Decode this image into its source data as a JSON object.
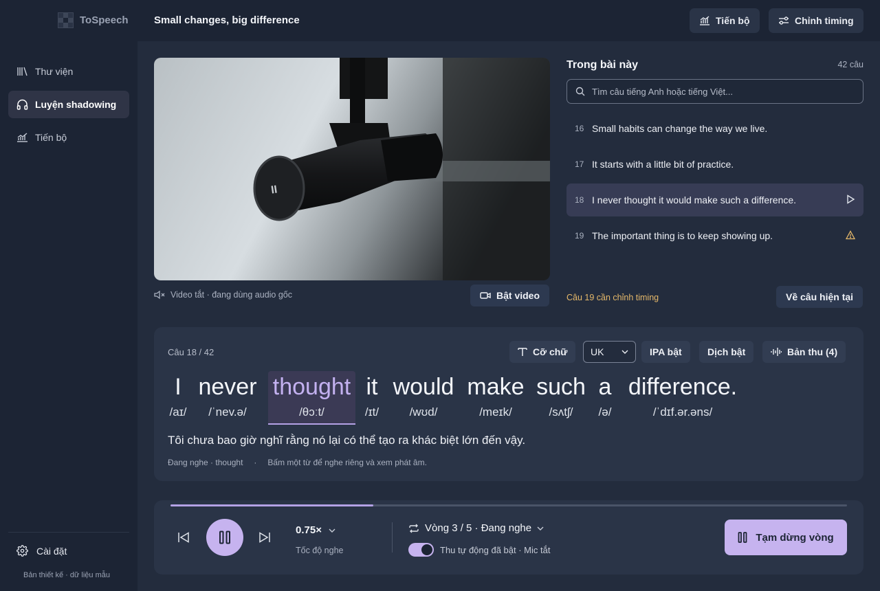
{
  "app": {
    "brand": "ToSpeech",
    "page_title": "Small changes, big difference"
  },
  "header": {
    "progress_label": "Tiến bộ",
    "timing_label": "Chỉnh timing"
  },
  "sidebar": {
    "items": [
      {
        "label": "Thư viện",
        "icon": "library-icon"
      },
      {
        "label": "Luyện shadowing",
        "icon": "headphones-icon",
        "active": true
      },
      {
        "label": "Tiến bộ",
        "icon": "chart-icon"
      }
    ],
    "settings_label": "Cài đặt",
    "footer": "Bản thiết kế · dữ liệu mẫu"
  },
  "video": {
    "caption": "Video tắt · đang dùng audio gốc",
    "button_label": "Bật video"
  },
  "lesson": {
    "title": "Trong bài này",
    "count": "42 câu",
    "search_placeholder": "Tìm câu tiếng Anh hoặc tiếng Việt...",
    "rows": [
      {
        "num": "16",
        "text": "Small habits can change the way we live."
      },
      {
        "num": "17",
        "text": "It starts with a little bit of practice."
      },
      {
        "num": "18",
        "text": "I never thought it would make such a difference.",
        "active": true,
        "icon": "play-icon"
      },
      {
        "num": "19",
        "text": "The important thing is to keep showing up.",
        "icon": "warning-icon"
      }
    ],
    "timing_note": "Câu 19 cần chỉnh timing",
    "current_button": "Về câu hiện tại"
  },
  "sentence": {
    "label": "Câu 18 / 42",
    "font_size_label": "Cỡ chữ",
    "accent": "UK",
    "ipa_label": "IPA bật",
    "translate_label": "Dịch bật",
    "recordings_label": "Bản thu (4)",
    "words": [
      {
        "text": "I",
        "ipa": "/aɪ/"
      },
      {
        "text": "never",
        "ipa": "/ˈnev.ə/"
      },
      {
        "text": "thought",
        "ipa": "/θɔːt/",
        "highlight": true
      },
      {
        "text": "it",
        "ipa": "/ɪt/"
      },
      {
        "text": "would",
        "ipa": "/wʊd/"
      },
      {
        "text": "make",
        "ipa": "/meɪk/"
      },
      {
        "text": "such",
        "ipa": "/sʌtʃ/"
      },
      {
        "text": "a",
        "ipa": "/ə/"
      },
      {
        "text": "difference.",
        "ipa": "/ˈdɪf.ər.əns/"
      }
    ],
    "translation": "Tôi chưa bao giờ nghĩ rằng nó lại có thể tạo ra khác biệt lớn đến vậy.",
    "status": "Đang nghe · thought",
    "separator": "·",
    "hint": "Bấm một từ để nghe riêng và xem phát âm."
  },
  "player": {
    "progress": 0.3,
    "speed": "0.75×",
    "speed_label": "Tốc độ nghe",
    "loop_label": "Vòng 3 / 5 · Đang nghe",
    "auto_record_label": "Thu tự động đã bật · Mic tắt",
    "auto_record_on": true,
    "pause_loop_label": "Tạm dừng vòng"
  },
  "colors": {
    "accent": "#c6b3ef",
    "background": "#1c2434",
    "panel": "#2a3447",
    "warning": "#e6b96a"
  }
}
